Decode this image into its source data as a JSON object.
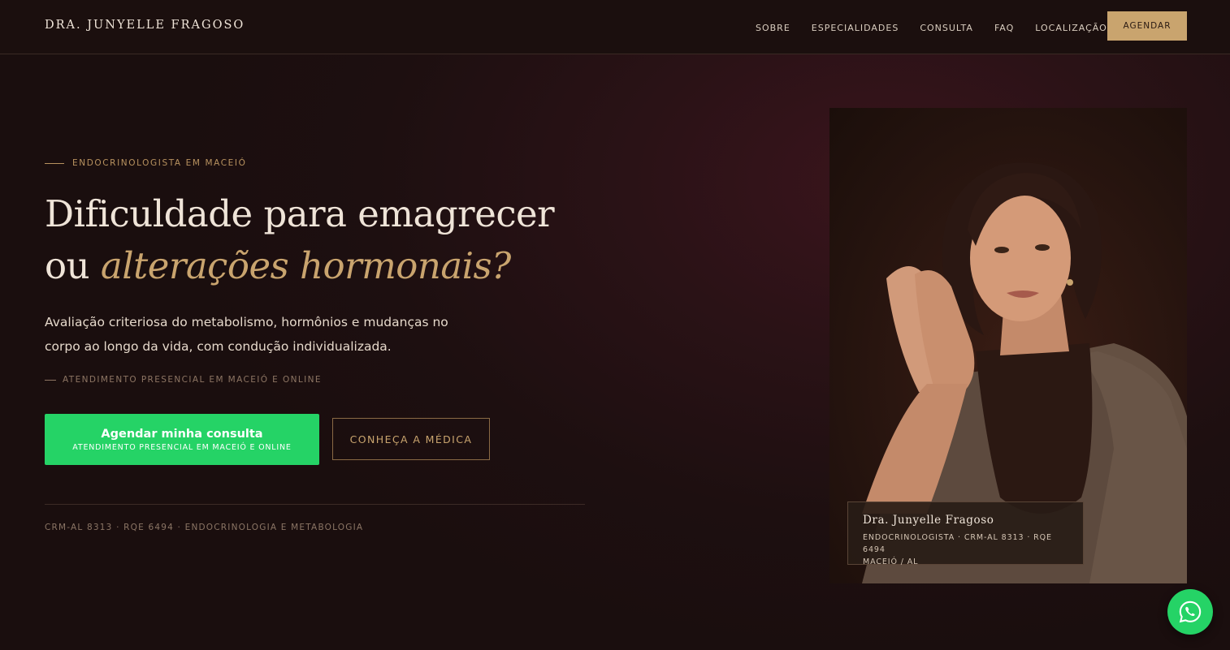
{
  "header": {
    "brand": "DRA. JUNYELLE FRAGOSO",
    "nav": [
      "SOBRE",
      "ESPECIALIDADES",
      "CONSULTA",
      "FAQ",
      "LOCALIZAÇÃO"
    ],
    "cta": "AGENDAR"
  },
  "hero": {
    "eyebrow": "ENDOCRINOLOGISTA EM MACEIÓ",
    "headline_line1": "Dificuldade para emagrecer",
    "headline_line2_prefix": "ou ",
    "headline_line2_accent": "alterações hormonais?",
    "lead": "Avaliação criteriosa do metabolismo, hormônios e mudanças no corpo ao longo da vida, com condução individualizada.",
    "subnote": "ATENDIMENTO PRESENCIAL EM MACEIÓ E ONLINE",
    "cta_primary_title": "Agendar minha consulta",
    "cta_primary_sub": "ATENDIMENTO PRESENCIAL EM MACEIÓ E ONLINE",
    "cta_secondary": "CONHEÇA A MÉDICA",
    "credentials": "CRM-AL 8313 · RQE 6494 · ENDOCRINOLOGIA E METABOLOGIA"
  },
  "photo_caption": {
    "name": "Dra. Junyelle Fragoso",
    "line1": "ENDOCRINOLOGISTA · CRM-AL 8313 · RQE 6494",
    "line2": "MACEIÓ / AL"
  },
  "colors": {
    "accent_gold": "#c9a46e",
    "whatsapp_green": "#25d366",
    "background": "#1d0f10"
  },
  "icons": {
    "floating_button": "whatsapp-icon"
  }
}
